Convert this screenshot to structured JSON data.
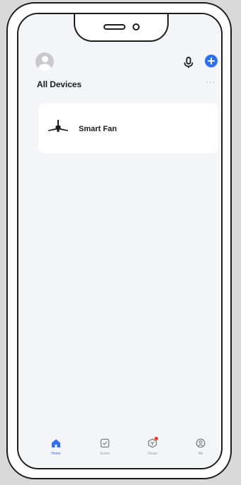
{
  "header": {
    "section_title": "All Devices",
    "more_label": "···"
  },
  "devices": [
    {
      "name": "Smart Fan",
      "icon": "ceiling-fan-icon"
    }
  ],
  "tabs": [
    {
      "label": "Home",
      "icon": "home-icon",
      "active": true
    },
    {
      "label": "Scene",
      "icon": "scene-check-icon",
      "active": false
    },
    {
      "label": "Smart",
      "icon": "smart-icon",
      "active": false,
      "badge": "red-dot"
    },
    {
      "label": "Me",
      "icon": "profile-icon",
      "active": false
    }
  ],
  "colors": {
    "accent": "#2f6ff1",
    "screen_bg": "#f4f5f9",
    "card_bg": "#ffffff",
    "badge": "#e53935",
    "frame": "#1d1d1d"
  }
}
